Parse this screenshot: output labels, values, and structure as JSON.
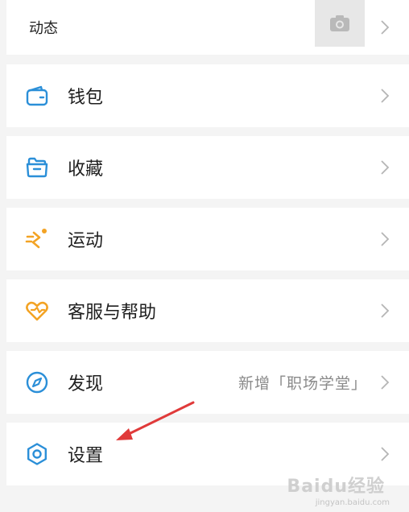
{
  "moments": {
    "label": "动态"
  },
  "menu": {
    "wallet": {
      "label": "钱包",
      "icon": "wallet-icon",
      "color": "#2b8fd8"
    },
    "favorites": {
      "label": "收藏",
      "icon": "folder-icon",
      "color": "#2b8fd8"
    },
    "sport": {
      "label": "运动",
      "icon": "running-icon",
      "color": "#f3a324"
    },
    "service": {
      "label": "客服与帮助",
      "icon": "heart-icon",
      "color": "#f3a324"
    },
    "discover": {
      "label": "发现",
      "icon": "compass-icon",
      "color": "#2b8fd8",
      "extra": "新增「职场学堂」"
    },
    "settings": {
      "label": "设置",
      "icon": "gear-icon",
      "color": "#2b8fd8"
    }
  },
  "annotation": {
    "arrow_color": "#e03a3a"
  },
  "watermark": {
    "text": "Baidu经验",
    "sub": "jingyan.baidu.com"
  }
}
